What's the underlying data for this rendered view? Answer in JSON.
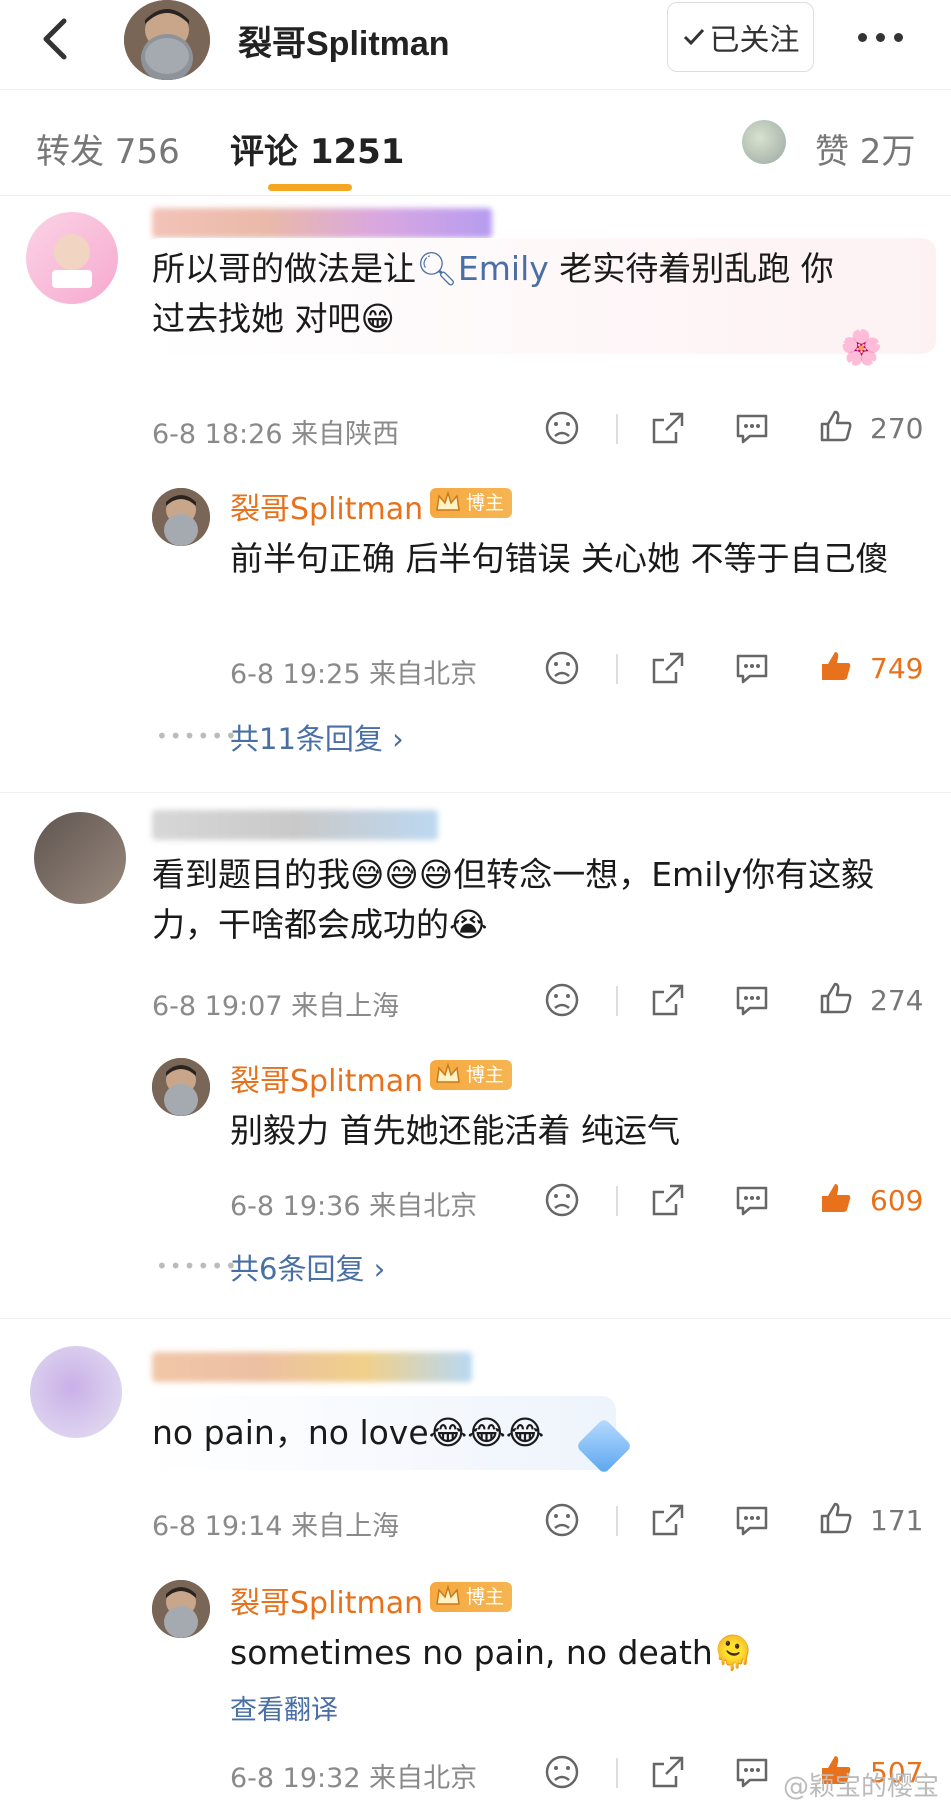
{
  "header": {
    "title": "裂哥Splitman",
    "follow_label": "已关注"
  },
  "tabs": {
    "repost": "转发 756",
    "comment": "评论 1251",
    "likes": "赞 2万"
  },
  "comments": [
    {
      "text_pre": "所以哥的做法是让",
      "mention": "Emily",
      "text_post": " 老实待着别乱跑 你",
      "text_line2": "过去找她 对吧",
      "emoji": "😁",
      "meta": "6-8 18:26 来自陕西",
      "likes": "270",
      "reply": {
        "author": "裂哥Splitman",
        "badge": "博主",
        "text": "前半句正确 后半句错误 关心她 不等于自己傻",
        "meta": "6-8 19:25 来自北京",
        "likes": "749"
      },
      "more_replies": "共11条回复"
    },
    {
      "text": "看到题目的我😅😅😅但转念一想，Emily你有这毅力，干啥都会成功的😭",
      "meta": "6-8 19:07 来自上海",
      "likes": "274",
      "reply": {
        "author": "裂哥Splitman",
        "badge": "博主",
        "text": "别毅力 首先她还能活着 纯运气",
        "meta": "6-8 19:36 来自北京",
        "likes": "609"
      },
      "more_replies": "共6条回复"
    },
    {
      "text": "no pain，no love😂😂😂",
      "meta": "6-8 19:14 来自上海",
      "likes": "171",
      "reply": {
        "author": "裂哥Splitman",
        "badge": "博主",
        "text": "sometimes no pain, no death🫠",
        "translate": "查看翻译",
        "meta": "6-8 19:32 来自北京",
        "likes": "507"
      }
    }
  ],
  "watermark": "@颖宝的樱宝",
  "colors": {
    "accent": "#e8711c",
    "link": "#4a6fa5",
    "tab_indicator": "#f5a623"
  },
  "icons": {
    "back": "chevron-left-icon",
    "follow_check": "check-icon",
    "more": "ellipsis-icon",
    "dislike": "frown-face-icon",
    "share": "share-icon",
    "reply": "comment-bubble-icon",
    "like": "thumbs-up-icon",
    "badge": "crown-icon"
  }
}
